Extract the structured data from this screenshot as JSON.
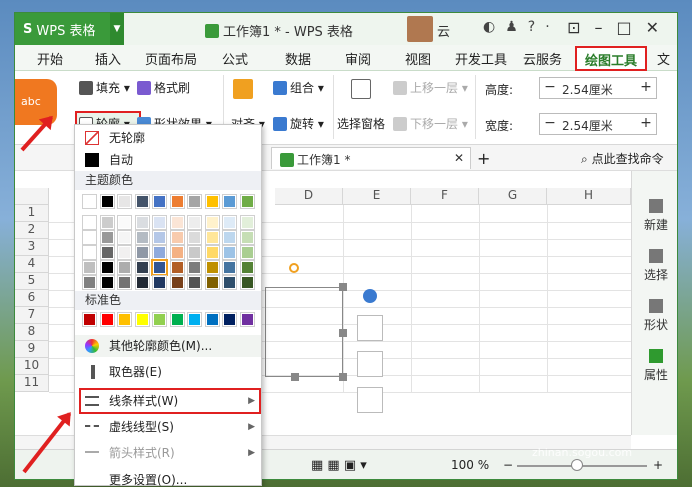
{
  "app": {
    "name": "WPS 表格",
    "doc_title": "工作簿1 * - WPS 表格",
    "user": "云"
  },
  "tabs": [
    "开始",
    "插入",
    "页面布局",
    "公式",
    "数据",
    "审阅",
    "视图",
    "开发工具",
    "云服务",
    "绘图工具",
    "文"
  ],
  "active_tab": "绘图工具",
  "ribbon": {
    "fill": "填充",
    "format_brush": "格式刷",
    "outline": "轮廓",
    "shape_effect": "形状效果",
    "align": "对齐",
    "combine": "组合",
    "rotate": "旋转",
    "selection_pane": "选择窗格",
    "move_up": "上移一层",
    "move_down": "下移一层",
    "height_label": "高度:",
    "width_label": "宽度:",
    "height_value": "2.54厘米",
    "width_value": "2.54厘米",
    "abc": "abc"
  },
  "toolbar2": {
    "doc_tab": "工作簿1 *",
    "search": "点此查找命令"
  },
  "columns": [
    "D",
    "E",
    "F",
    "G",
    "H"
  ],
  "rows": [
    "1",
    "2",
    "3",
    "4",
    "5",
    "6",
    "7",
    "8",
    "9",
    "10",
    "11"
  ],
  "right_pane": [
    "新建",
    "选择",
    "形状",
    "属性"
  ],
  "status": {
    "zoom": "100 %"
  },
  "menu": {
    "no_outline": "无轮廓",
    "auto": "自动",
    "theme_colors": "主题颜色",
    "standard_colors": "标准色",
    "more_colors": "其他轮廓颜色(M)...",
    "eyedropper": "取色器(E)",
    "line_style": "线条样式(W)",
    "dash_style": "虚线线型(S)",
    "arrow_style": "箭头样式(R)",
    "more_settings": "更多设置(O)..."
  },
  "theme_colors": [
    "#ffffff",
    "#000000",
    "#e7e6e6",
    "#44546a",
    "#4472c4",
    "#ed7d31",
    "#a5a5a5",
    "#ffc000",
    "#5b9bd5",
    "#70ad47"
  ],
  "standard_colors": [
    "#c00000",
    "#ff0000",
    "#ffc000",
    "#ffff00",
    "#92d050",
    "#00b050",
    "#00b0f0",
    "#0070c0",
    "#002060",
    "#7030a0"
  ],
  "watermark": {
    "logo": "搜狗指南",
    "url": "zhinan.sogou.com"
  }
}
